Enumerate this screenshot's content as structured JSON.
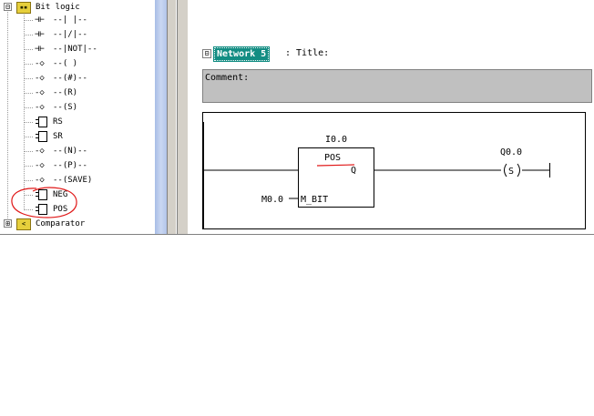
{
  "tree": {
    "root": {
      "expander": "⊟",
      "icon_text": "▪▪",
      "label": "Bit logic"
    },
    "items": [
      {
        "label": "--|  |--",
        "icon": "contact-no-icon",
        "glyph": "⊣⊢"
      },
      {
        "label": "--|/|--",
        "icon": "contact-nc-icon",
        "glyph": "⊣⊢"
      },
      {
        "label": "--|NOT|--",
        "icon": "not-contact-icon",
        "glyph": "⊣⊢"
      },
      {
        "label": "--( )",
        "icon": "coil-icon",
        "glyph": "-◇"
      },
      {
        "label": "--(#)--",
        "icon": "midline-coil-icon",
        "glyph": "-◇"
      },
      {
        "label": "--(R)",
        "icon": "reset-coil-icon",
        "glyph": "-◇"
      },
      {
        "label": "--(S)",
        "icon": "set-coil-icon",
        "glyph": "-◇"
      },
      {
        "label": "RS",
        "icon": "box-icon",
        "glyph": ""
      },
      {
        "label": "SR",
        "icon": "box-icon",
        "glyph": ""
      },
      {
        "label": "--(N)--",
        "icon": "coil-icon",
        "glyph": "-◇"
      },
      {
        "label": "--(P)--",
        "icon": "coil-icon",
        "glyph": "-◇"
      },
      {
        "label": "--(SAVE)",
        "icon": "coil-icon",
        "glyph": "-◇"
      },
      {
        "label": "NEG",
        "icon": "box-icon",
        "glyph": ""
      },
      {
        "label": "POS",
        "icon": "box-icon",
        "glyph": ""
      }
    ],
    "next_folder": {
      "expander": "⊞",
      "icon_text": "<",
      "label": "Comparator"
    }
  },
  "editor": {
    "collapse": "⊟",
    "network_title": "Network 5",
    "title_suffix": ": Title:",
    "comment_label": "Comment:"
  },
  "ladder": {
    "box_label": "POS",
    "box_operand": "I0.0",
    "box_output_pin": "Q",
    "box_input_pin": "M_BIT",
    "memory_operand": "M0.0",
    "coil_operand": "Q0.0",
    "coil_symbol": "S"
  },
  "colors": {
    "network_highlight": "#138d83",
    "annotation_red": "#e01818",
    "comment_bg": "#c0c0c0"
  }
}
